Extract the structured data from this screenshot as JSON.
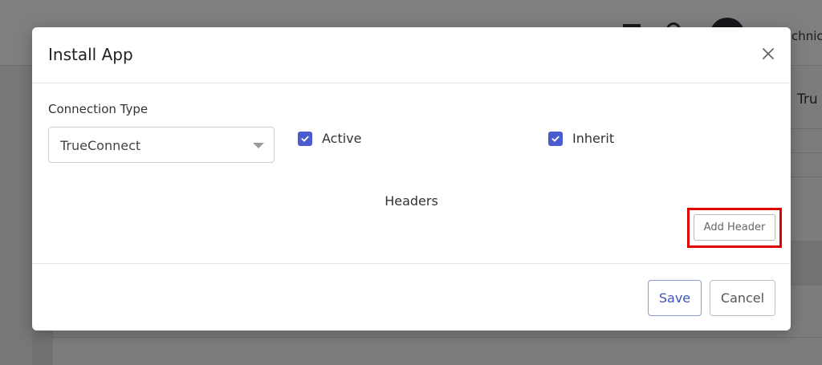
{
  "background": {
    "user_text": "chnica",
    "column_text": "Tru"
  },
  "modal": {
    "title": "Install App",
    "close_icon": "close-icon",
    "connection_type": {
      "label": "Connection Type",
      "value": "TrueConnect"
    },
    "active": {
      "label": "Active",
      "checked": true
    },
    "inherit": {
      "label": "Inherit",
      "checked": true
    },
    "headers_heading": "Headers",
    "add_header_label": "Add Header",
    "save_label": "Save",
    "cancel_label": "Cancel"
  },
  "colors": {
    "accent": "#4a5bd0",
    "highlight": "#e00000",
    "save_text": "#3f55b8"
  }
}
